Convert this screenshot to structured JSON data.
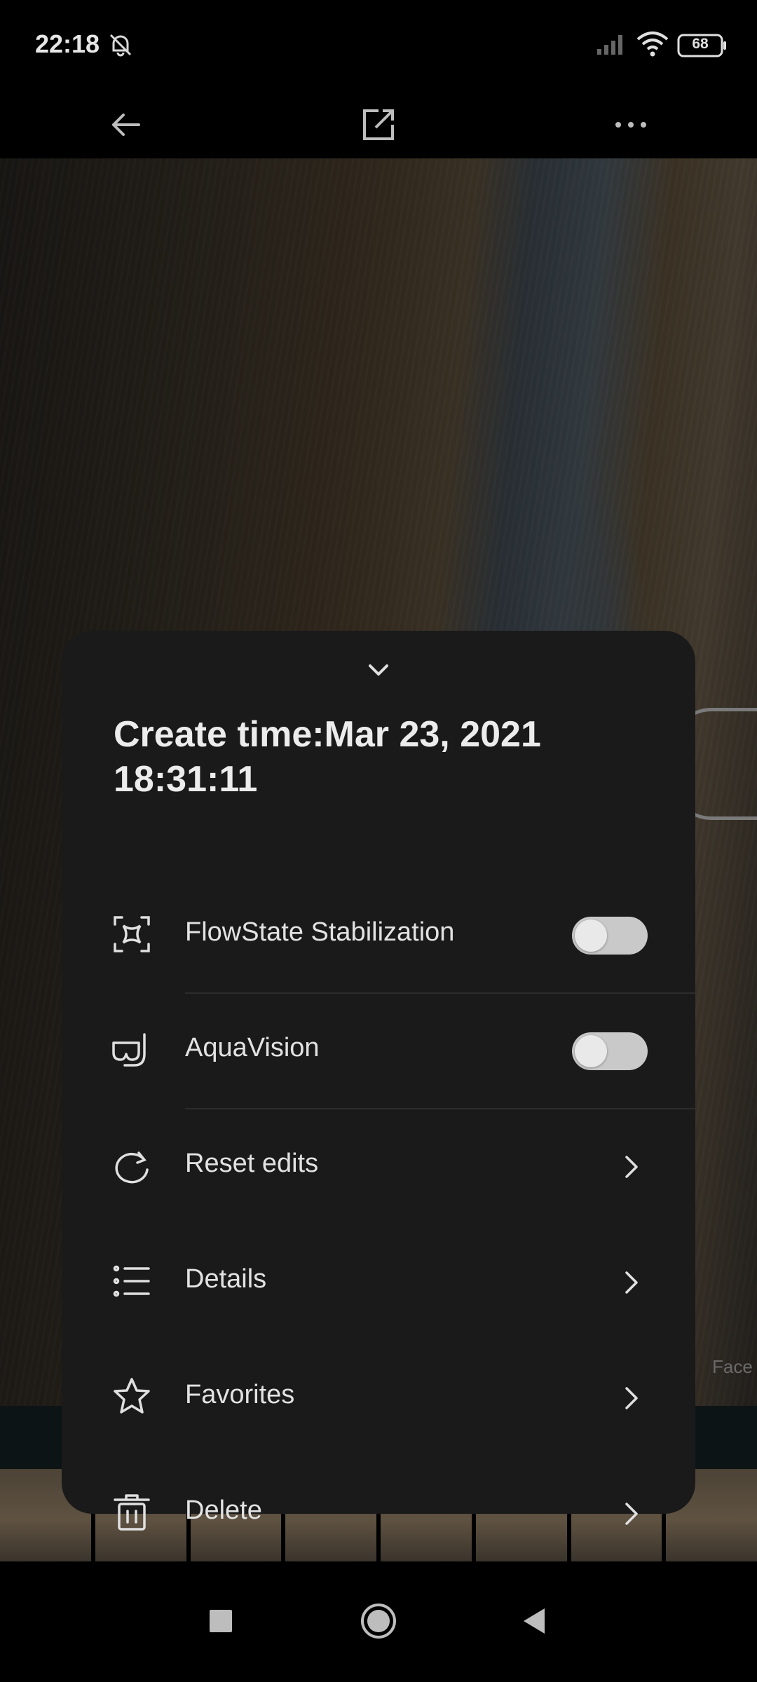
{
  "status_bar": {
    "time": "22:18",
    "battery": "68",
    "icons": [
      "bell-off-icon",
      "signal-icon",
      "wifi-icon",
      "battery-icon"
    ]
  },
  "top_bar": {
    "icons": [
      "back-arrow-icon",
      "open-external-icon",
      "more-options-icon"
    ]
  },
  "photo_viewer": {
    "side_tool_label": "Face"
  },
  "sheet": {
    "create_time": "Create time:Mar 23, 2021 18:31:11",
    "items": [
      {
        "label": "FlowState Stabilization",
        "icon": "stabilization-icon",
        "control": "toggle",
        "on": false
      },
      {
        "label": "AquaVision",
        "icon": "snorkel-mask-icon",
        "control": "toggle",
        "on": false
      },
      {
        "label": "Reset edits",
        "icon": "reset-icon",
        "control": "arrow"
      },
      {
        "label": "Details",
        "icon": "list-icon",
        "control": "arrow"
      },
      {
        "label": "Favorites",
        "icon": "star-icon",
        "control": "arrow"
      },
      {
        "label": "Delete",
        "icon": "trash-icon",
        "control": "arrow"
      }
    ]
  },
  "nav_bar": {
    "icons": [
      "recents-square-icon",
      "home-circle-icon",
      "back-triangle-icon"
    ]
  }
}
